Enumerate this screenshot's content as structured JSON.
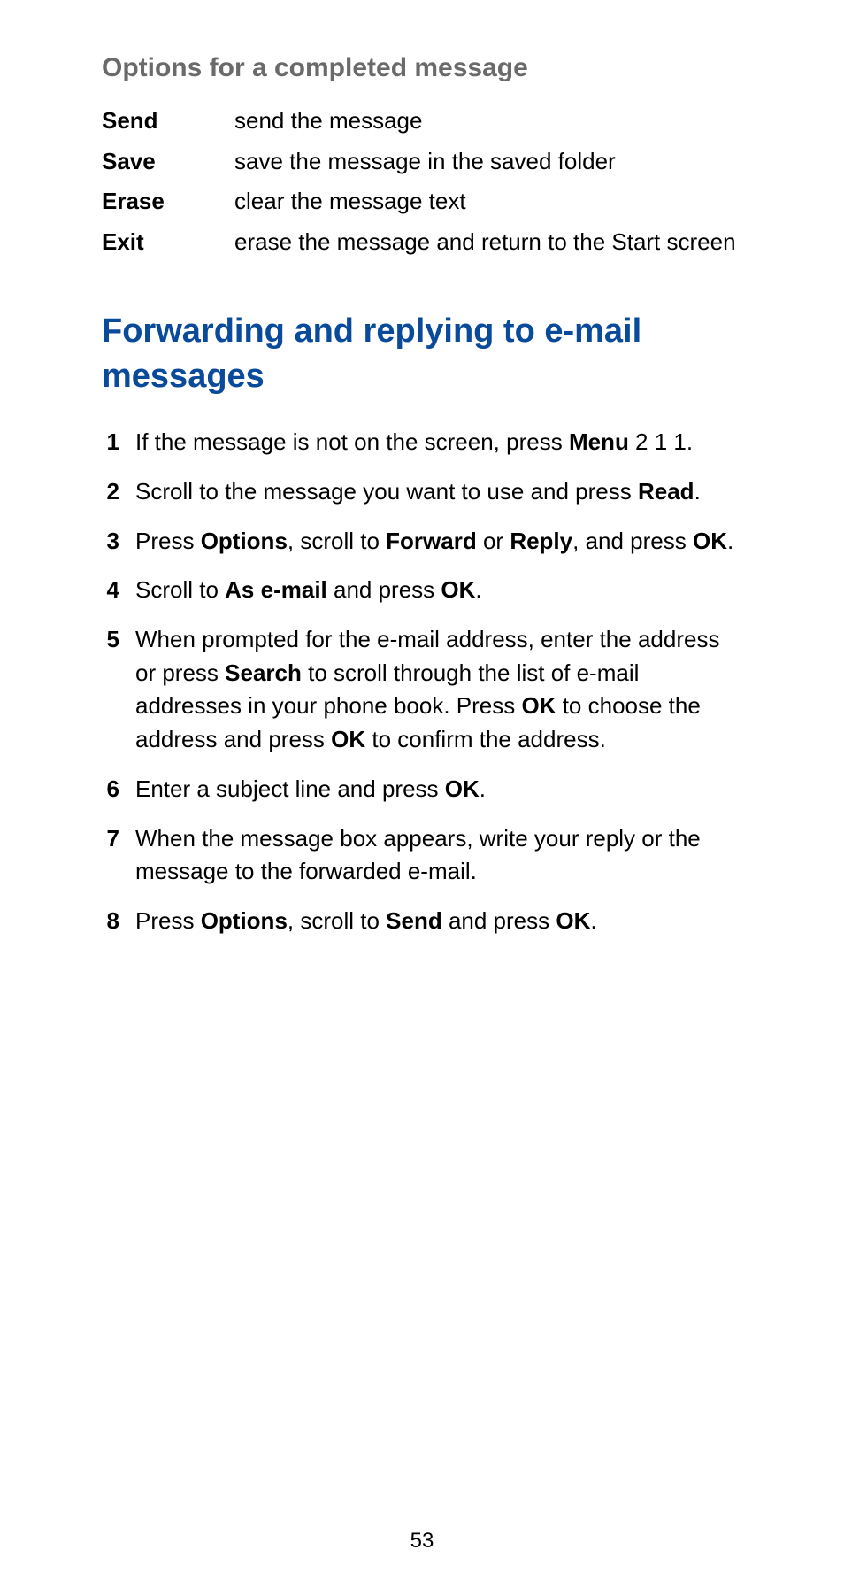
{
  "section_title": "Options for a completed message",
  "options": [
    {
      "label": "Send",
      "desc": "send the message"
    },
    {
      "label": "Save",
      "desc": "save the message in the saved folder"
    },
    {
      "label": "Erase",
      "desc": "clear the message text"
    },
    {
      "label": "Exit",
      "desc": "erase the message and return to the Start screen"
    }
  ],
  "main_heading": "Forwarding and replying to e-mail messages",
  "steps": [
    {
      "num": "1",
      "parts": [
        {
          "t": "If the message is not on the screen, press ",
          "b": false
        },
        {
          "t": "Menu",
          "b": true
        },
        {
          "t": " 2 1 1.",
          "b": false
        }
      ]
    },
    {
      "num": "2",
      "parts": [
        {
          "t": "Scroll to the message you want to use and press ",
          "b": false
        },
        {
          "t": "Read",
          "b": true
        },
        {
          "t": ".",
          "b": false
        }
      ]
    },
    {
      "num": "3",
      "parts": [
        {
          "t": "Press ",
          "b": false
        },
        {
          "t": "Options",
          "b": true
        },
        {
          "t": ", scroll to ",
          "b": false
        },
        {
          "t": "Forward",
          "b": true
        },
        {
          "t": " or ",
          "b": false
        },
        {
          "t": "Reply",
          "b": true
        },
        {
          "t": ", and press ",
          "b": false
        },
        {
          "t": "OK",
          "b": true
        },
        {
          "t": ".",
          "b": false
        }
      ]
    },
    {
      "num": "4",
      "parts": [
        {
          "t": "Scroll to ",
          "b": false
        },
        {
          "t": "As e-mail",
          "b": true
        },
        {
          "t": " and press ",
          "b": false
        },
        {
          "t": "OK",
          "b": true
        },
        {
          "t": ".",
          "b": false
        }
      ]
    },
    {
      "num": "5",
      "parts": [
        {
          "t": "When prompted for the e-mail address, enter the address or press ",
          "b": false
        },
        {
          "t": "Search",
          "b": true
        },
        {
          "t": " to scroll through the list of e-mail addresses in your phone book. Press ",
          "b": false
        },
        {
          "t": "OK",
          "b": true
        },
        {
          "t": " to choose the address and press ",
          "b": false
        },
        {
          "t": "OK",
          "b": true
        },
        {
          "t": " to confirm the address.",
          "b": false
        }
      ]
    },
    {
      "num": "6",
      "parts": [
        {
          "t": "Enter a subject line and press ",
          "b": false
        },
        {
          "t": "OK",
          "b": true
        },
        {
          "t": ".",
          "b": false
        }
      ]
    },
    {
      "num": "7",
      "parts": [
        {
          "t": "When the message box appears, write your reply or the message to the forwarded e-mail.",
          "b": false
        }
      ]
    },
    {
      "num": "8",
      "parts": [
        {
          "t": "Press ",
          "b": false
        },
        {
          "t": "Options",
          "b": true
        },
        {
          "t": ", scroll to ",
          "b": false
        },
        {
          "t": "Send",
          "b": true
        },
        {
          "t": " and press ",
          "b": false
        },
        {
          "t": "OK",
          "b": true
        },
        {
          "t": ".",
          "b": false
        }
      ]
    }
  ],
  "page_number": "53"
}
